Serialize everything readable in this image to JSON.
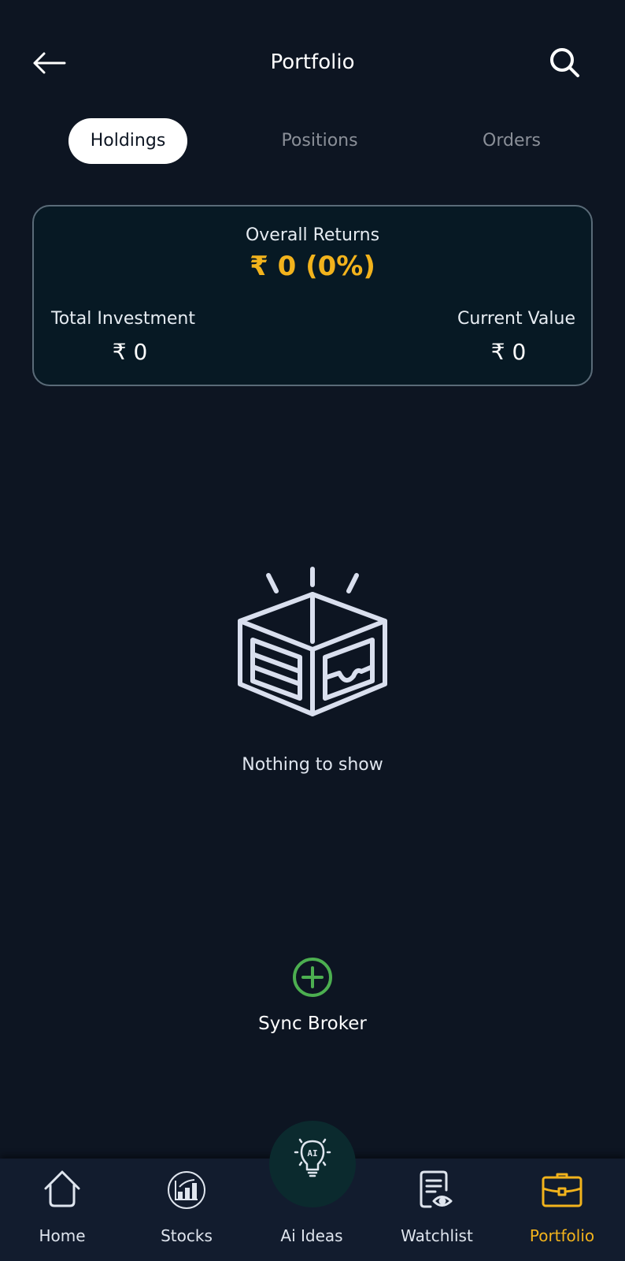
{
  "header": {
    "title": "Portfolio",
    "back_icon": "arrow-left-icon",
    "search_icon": "search-icon"
  },
  "tabs": [
    {
      "label": "Holdings",
      "active": true
    },
    {
      "label": "Positions",
      "active": false
    },
    {
      "label": "Orders",
      "active": false
    }
  ],
  "summary": {
    "overall_returns_label": "Overall Returns",
    "overall_returns_value": "₹ 0 (0%)",
    "total_investment_label": "Total Investment",
    "total_investment_value": "₹ 0",
    "current_value_label": "Current Value",
    "current_value_value": "₹ 0"
  },
  "empty_state": {
    "icon": "open-box-icon",
    "message": "Nothing to show"
  },
  "sync_broker": {
    "icon": "plus-circle-icon",
    "label": "Sync Broker"
  },
  "bottom_nav": {
    "items": [
      {
        "label": "Home",
        "icon": "home-icon",
        "active": false
      },
      {
        "label": "Stocks",
        "icon": "stocks-chart-icon",
        "active": false
      },
      {
        "label": "Ai Ideas",
        "icon": "ai-bulb-icon",
        "active": false
      },
      {
        "label": "Watchlist",
        "icon": "watchlist-icon",
        "active": false
      },
      {
        "label": "Portfolio",
        "icon": "briefcase-icon",
        "active": true
      }
    ]
  },
  "colors": {
    "background": "#0d1522",
    "card_background": "#071924",
    "card_border": "#5a6b78",
    "accent_yellow": "#f2b31c",
    "sync_green": "#4caf50",
    "inactive_tab": "#8a8f98",
    "nav_background": "#121c2e",
    "ai_bubble": "#0b2a2e"
  }
}
